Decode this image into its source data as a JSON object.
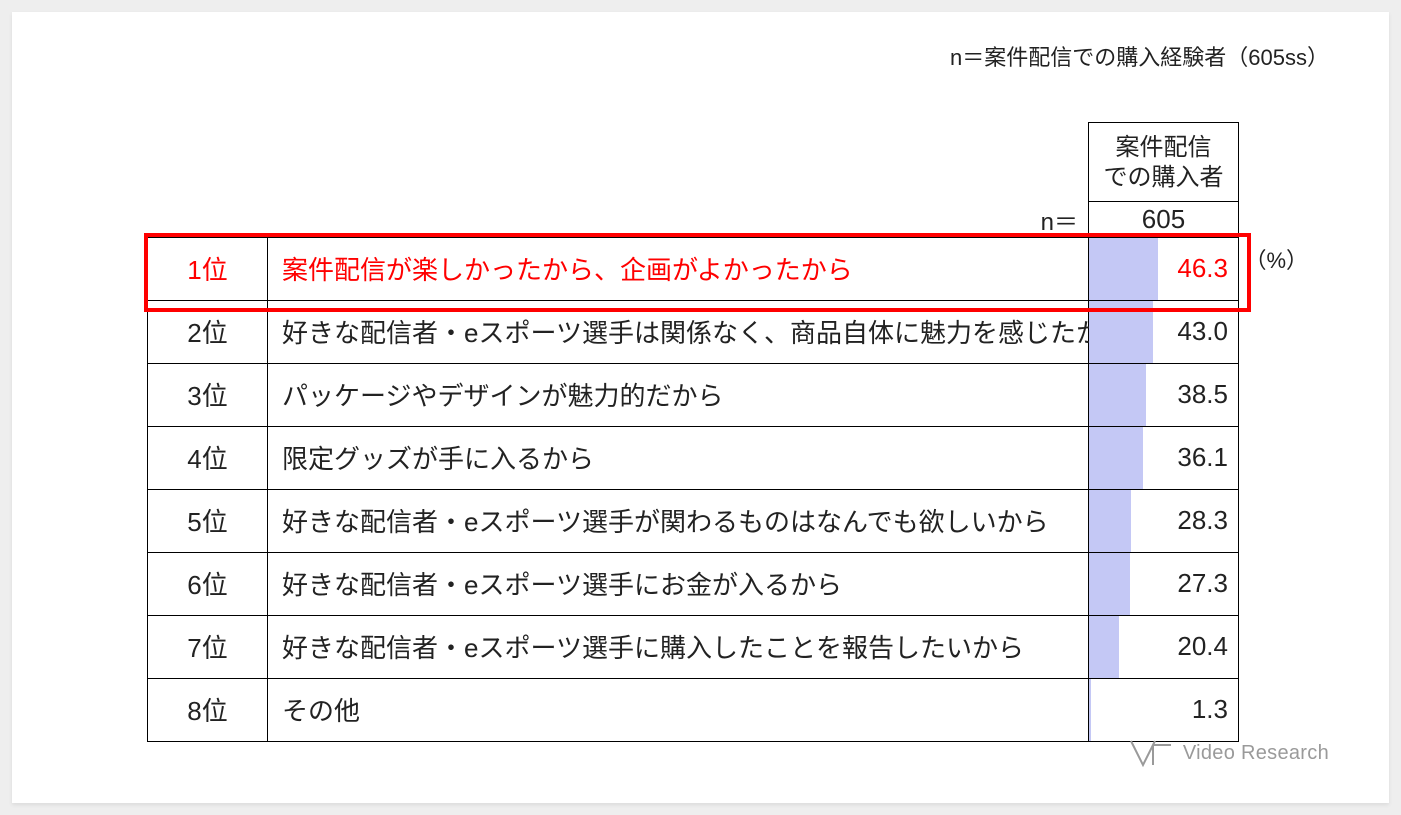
{
  "note_top": "n＝案件配信での購入経験者（605ss）",
  "header": {
    "column_title_l1": "案件配信",
    "column_title_l2": "での購入者",
    "n_prefix": "n＝",
    "n_value": "605",
    "unit": "（%）"
  },
  "logo_text": "Video Research",
  "chart_data": {
    "type": "bar",
    "title": "",
    "xlabel": "",
    "ylabel": "",
    "unit": "%",
    "n": 605,
    "highlight_index": 0,
    "bar_max": 100,
    "categories": [
      "1位",
      "2位",
      "3位",
      "4位",
      "5位",
      "6位",
      "7位",
      "8位"
    ],
    "series": [
      {
        "name": "案件配信での購入者",
        "values": [
          46.3,
          43.0,
          38.5,
          36.1,
          28.3,
          27.3,
          20.4,
          1.3
        ]
      }
    ],
    "row_labels": [
      "案件配信が楽しかったから、企画がよかったから",
      "好きな配信者・eスポーツ選手は関係なく、商品自体に魅力を感じたから",
      "パッケージやデザインが魅力的だから",
      "限定グッズが手に入るから",
      "好きな配信者・eスポーツ選手が関わるものはなんでも欲しいから",
      "好きな配信者・eスポーツ選手にお金が入るから",
      "好きな配信者・eスポーツ選手に購入したことを報告したいから",
      "その他"
    ]
  }
}
